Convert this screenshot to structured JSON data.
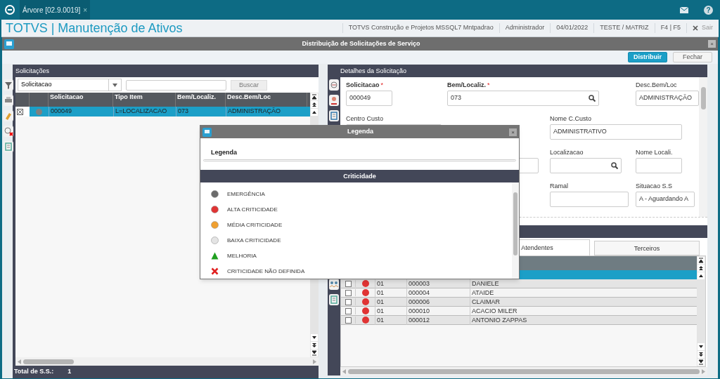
{
  "app_bar": {
    "tab": {
      "label": "Árvore [02.9.0019]",
      "close": "×"
    },
    "help": "?"
  },
  "header": {
    "title": "TOTVS | Manutenção de Ativos",
    "info": [
      "TOTVS Construção e Projetos MSSQL7 Mntpadrao",
      "Administrador",
      "04/01/2022",
      "TESTE / MATRIZ",
      "F4 | F5"
    ],
    "exit": "Sair"
  },
  "window": {
    "title": "Distribuição de Solicitações de Serviço",
    "close": "×",
    "buttons": [
      {
        "label": "Distribuir",
        "primary": true
      },
      {
        "label": "Fechar",
        "primary": false
      }
    ]
  },
  "requests_panel": {
    "title": "Solicitações",
    "search": {
      "field": "Solicitacao",
      "button": "Buscar"
    },
    "table": {
      "columns": [
        "Solicitacao",
        "Tipo Item",
        "Bem/Localiz.",
        "Desc.Bem/Loc"
      ],
      "rows": [
        {
          "checked": true,
          "selected": true,
          "color": "#808080",
          "cells": [
            "000049",
            "L=LOCALIZACAO",
            "073",
            "ADMINISTRAÇÃO"
          ]
        }
      ]
    },
    "total_label": "Total de S.S.:",
    "total": "1"
  },
  "details_panel": {
    "title": "Detalhes da Solicitação",
    "required_mark": "*",
    "fields": [
      {
        "label": "Solicitacao",
        "required": true,
        "value": "000049",
        "lookup": false
      },
      {
        "label": "Bem/Localiz.",
        "required": true,
        "value": "073",
        "lookup": true
      },
      {
        "label": "Desc.Bem/Loc",
        "required": false,
        "value": "ADMINISTRAÇÃO",
        "lookup": false
      },
      {
        "label": "Centro Custo",
        "required": false
      },
      {
        "label": "Nome C.Custo",
        "required": false,
        "value": "ADMINISTRATIVO",
        "lookup": false
      },
      {
        "label": "Localizacao",
        "required": false,
        "lookup": true
      },
      {
        "label": "Nome Locali.",
        "required": false,
        "lookup": false
      },
      {
        "label": "Ramal",
        "required": false,
        "lookup": false
      },
      {
        "label": "Situacao S.S",
        "required": false,
        "value": "A - Aguardando A",
        "lookup": false
      }
    ],
    "tabs": [
      {
        "label": "Atendentes",
        "selected": true
      },
      {
        "label": "Terceiros",
        "selected": false
      }
    ],
    "grid": {
      "rows": [
        {
          "checked": false,
          "color": "#e03434",
          "cells": [
            "01",
            "000003",
            "DANIELE"
          ]
        },
        {
          "checked": false,
          "color": "#e03434",
          "cells": [
            "01",
            "000004",
            "ATAIDE"
          ]
        },
        {
          "checked": false,
          "color": "#e03434",
          "cells": [
            "01",
            "000006",
            "CLAIMAR"
          ]
        },
        {
          "checked": false,
          "color": "#e03434",
          "cells": [
            "01",
            "000010",
            "ACACIO MILER"
          ]
        },
        {
          "checked": false,
          "color": "#e03434",
          "cells": [
            "01",
            "000012",
            "ANTONIO ZAPPAS"
          ]
        }
      ]
    }
  },
  "legend_dialog": {
    "title": "Legenda",
    "close": "×",
    "heading": "Legenda",
    "section": "Criticidade",
    "items": [
      {
        "kind": "dot",
        "color": "#6b6b6b",
        "label": "EMERGÊNCIA"
      },
      {
        "kind": "dot",
        "color": "#e03434",
        "label": "ALTA CRITICIDADE"
      },
      {
        "kind": "dot",
        "color": "#f0a030",
        "label": "MÉDIA CRITICIDADE"
      },
      {
        "kind": "dot",
        "color": "#e4e4e4",
        "label": "BAIXA CRITICIDADE"
      },
      {
        "kind": "triangle",
        "color": "#20a020",
        "label": "MELHORIA"
      },
      {
        "kind": "cross",
        "color": "#e02020",
        "label": "CRITICIDADE NÃO DEFINIDA"
      }
    ]
  }
}
